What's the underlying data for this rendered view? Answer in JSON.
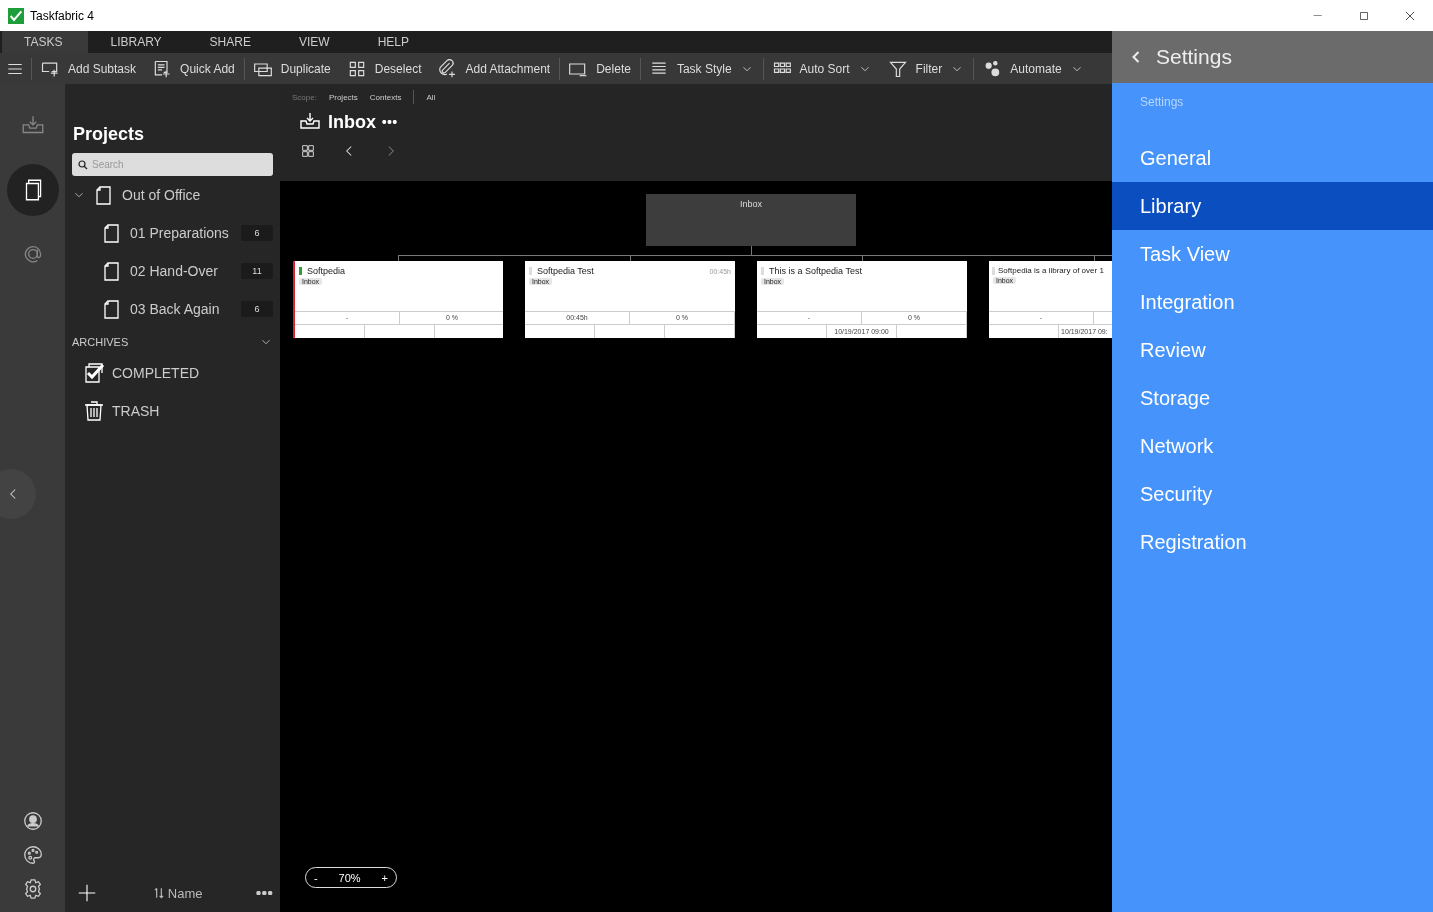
{
  "window": {
    "title": "Taskfabric 4"
  },
  "menu": [
    {
      "label": "TASKS",
      "selected": true
    },
    {
      "label": "LIBRARY",
      "selected": false
    },
    {
      "label": "SHARE",
      "selected": false
    },
    {
      "label": "VIEW",
      "selected": false
    },
    {
      "label": "HELP",
      "selected": false
    }
  ],
  "toolbar": [
    {
      "kind": "subtask",
      "label": "Add Subtask",
      "dropdown": false,
      "separator_before": true
    },
    {
      "kind": "quickadd",
      "label": "Quick Add",
      "dropdown": false,
      "separator_before": false
    },
    {
      "kind": "duplicate",
      "label": "Duplicate",
      "dropdown": false,
      "separator_before": true
    },
    {
      "kind": "deselect",
      "label": "Deselect",
      "dropdown": false,
      "separator_before": false
    },
    {
      "kind": "attach",
      "label": "Add Attachment",
      "dropdown": false,
      "separator_before": false
    },
    {
      "kind": "delete",
      "label": "Delete",
      "dropdown": false,
      "separator_before": true
    },
    {
      "kind": "style",
      "label": "Task Style",
      "dropdown": true,
      "separator_before": true
    },
    {
      "kind": "sort",
      "label": "Auto Sort",
      "dropdown": true,
      "separator_before": true
    },
    {
      "kind": "filter",
      "label": "Filter",
      "dropdown": true,
      "separator_before": false
    },
    {
      "kind": "automate",
      "label": "Automate",
      "dropdown": true,
      "separator_before": true
    }
  ],
  "rail": {
    "top": [
      {
        "kind": "inbox",
        "selected": false
      },
      {
        "kind": "projects",
        "selected": true
      },
      {
        "kind": "contexts",
        "selected": false
      }
    ],
    "bottom": [
      {
        "kind": "user"
      },
      {
        "kind": "palette"
      },
      {
        "kind": "settings"
      }
    ]
  },
  "sidebar": {
    "title": "Projects",
    "search": {
      "placeholder": "Search"
    },
    "tree": [
      {
        "label": "Out of Office",
        "expanded": true,
        "children": [
          {
            "label": "01 Preparations",
            "count": "6"
          },
          {
            "label": "02 Hand-Over",
            "count": "11"
          },
          {
            "label": "03 Back Again",
            "count": "6"
          }
        ]
      }
    ],
    "archives": {
      "label": "ARCHIVES",
      "expanded": true,
      "items": [
        {
          "kind": "completed",
          "label": "COMPLETED"
        },
        {
          "kind": "trash",
          "label": "TRASH"
        }
      ]
    },
    "sort": {
      "label": "Name"
    }
  },
  "canvas": {
    "scope": {
      "label": "Scope:",
      "options": [
        {
          "label": "Projects"
        },
        {
          "label": "Contexts"
        },
        {
          "label": "All"
        }
      ]
    },
    "title": "Inbox",
    "root": {
      "label": "Inbox"
    },
    "cards": [
      {
        "title": "Softpedia",
        "tag": "Inbox",
        "color": "#2e9e2e",
        "flagged": true,
        "duration": "-",
        "progress": "0 %"
      },
      {
        "title": "Softpedia Test",
        "tag": "Inbox",
        "color": "#dddddd",
        "flagged": false,
        "estimate": "00:45h",
        "duration": "00:45h",
        "progress": "0 %"
      },
      {
        "title": "This is a Softpedia Test",
        "tag": "Inbox",
        "color": "#dddddd",
        "flagged": false,
        "duration": "-",
        "progress": "0 %",
        "due": "10/19/2017 09:00"
      },
      {
        "title": "Softpedia is a library of over 1",
        "tag": "Inbox",
        "color": "#dddddd",
        "flagged": false,
        "duration": "-",
        "due": "10/19/2017 09:"
      }
    ],
    "zoom": {
      "minus": "-",
      "value": "70%",
      "plus": "+"
    }
  },
  "settings": {
    "title": "Settings",
    "crumb": "Settings",
    "items": [
      {
        "label": "General",
        "selected": false
      },
      {
        "label": "Library",
        "selected": true
      },
      {
        "label": "Task View",
        "selected": false
      },
      {
        "label": "Integration",
        "selected": false
      },
      {
        "label": "Review",
        "selected": false
      },
      {
        "label": "Storage",
        "selected": false
      },
      {
        "label": "Network",
        "selected": false
      },
      {
        "label": "Security",
        "selected": false
      },
      {
        "label": "Registration",
        "selected": false
      }
    ]
  }
}
